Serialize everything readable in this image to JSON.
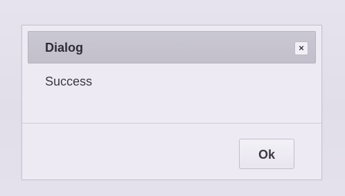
{
  "dialog": {
    "title": "Dialog",
    "close_symbol": "×",
    "message": "Success",
    "ok_label": "Ok"
  },
  "icons": {
    "close": "close-icon"
  },
  "colors": {
    "background": "#e4e1ec",
    "titlebar": "#c6c3cf",
    "dialog_body": "#edeaf3"
  }
}
